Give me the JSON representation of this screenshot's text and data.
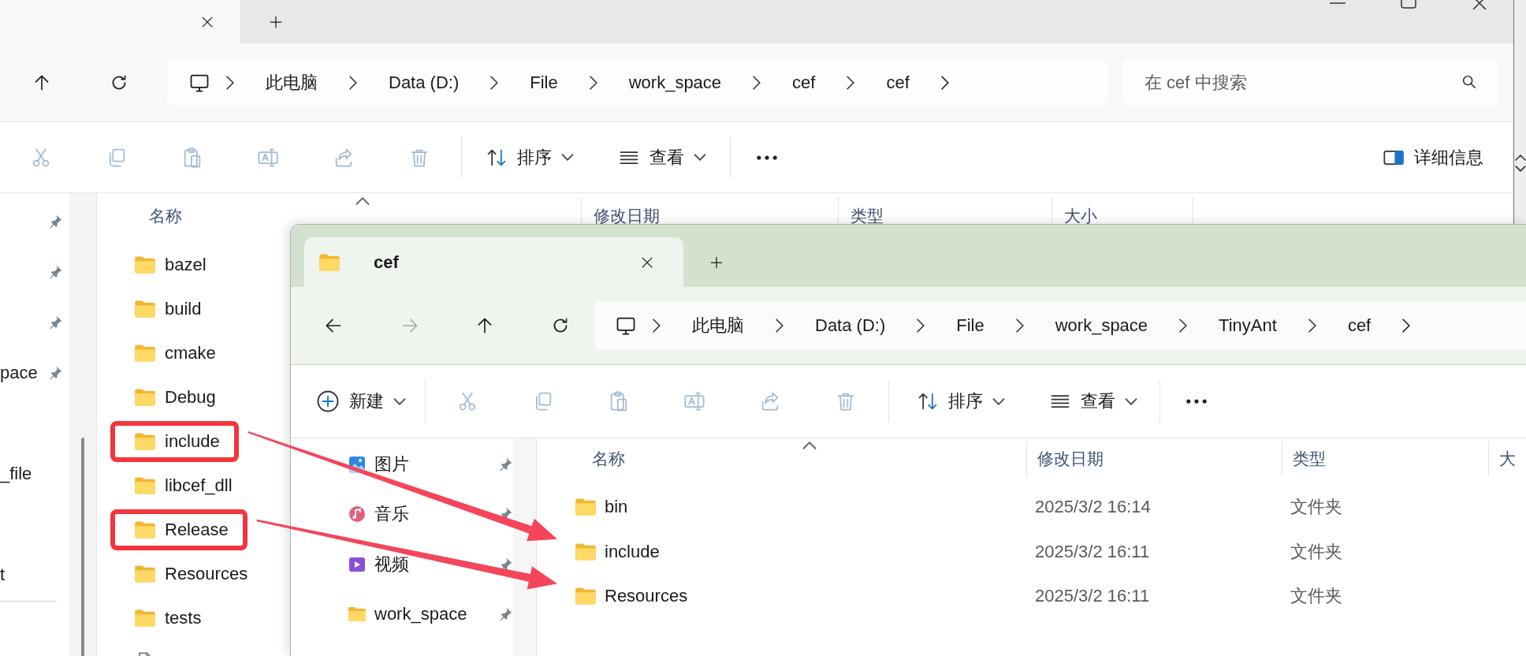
{
  "back_window": {
    "address": {
      "segments": [
        "此电脑",
        "Data (D:)",
        "File",
        "work_space",
        "cef",
        "cef"
      ]
    },
    "search": {
      "placeholder": "在 cef 中搜索"
    },
    "toolbar": {
      "actions": [
        {
          "kind": "cut",
          "disabled": true
        },
        {
          "kind": "copy",
          "disabled": true
        },
        {
          "kind": "paste",
          "disabled": true
        },
        {
          "kind": "rename",
          "disabled": true
        },
        {
          "kind": "share",
          "disabled": true
        },
        {
          "kind": "delete",
          "disabled": true
        }
      ],
      "sort": "排序",
      "view": "查看",
      "details": "详细信息"
    },
    "nav_pane": {
      "items": [
        {
          "pinned": true
        },
        {
          "pinned": true
        },
        {
          "pinned": true
        },
        {
          "label": "pace",
          "pinned": true
        },
        {
          "label": "_file",
          "pinned": false
        },
        {
          "label": "t",
          "pinned": false
        }
      ]
    },
    "file_list": {
      "columns": [
        "名称",
        "修改日期",
        "类型",
        "大小"
      ],
      "rows": [
        {
          "kind": "folder",
          "name": "bazel",
          "highlighted": false
        },
        {
          "kind": "folder",
          "name": "build",
          "highlighted": false
        },
        {
          "kind": "folder",
          "name": "cmake",
          "highlighted": false
        },
        {
          "kind": "folder",
          "name": "Debug",
          "highlighted": false
        },
        {
          "kind": "folder",
          "name": "include",
          "highlighted": true
        },
        {
          "kind": "folder",
          "name": "libcef_dll",
          "highlighted": false
        },
        {
          "kind": "folder",
          "name": "Release",
          "highlighted": true
        },
        {
          "kind": "folder",
          "name": "Resources",
          "highlighted": false
        },
        {
          "kind": "folder",
          "name": "tests",
          "highlighted": false
        },
        {
          "kind": "file",
          "highlighted": false
        }
      ]
    }
  },
  "front_window": {
    "tab": {
      "title": "cef",
      "selected": true
    },
    "forward_disabled": true,
    "address": {
      "segments": [
        "此电脑",
        "Data (D:)",
        "File",
        "work_space",
        "TinyAnt",
        "cef"
      ]
    },
    "toolbar": {
      "new": "新建",
      "actions": [
        {
          "kind": "cut",
          "disabled": true
        },
        {
          "kind": "copy",
          "disabled": true
        },
        {
          "kind": "paste",
          "disabled": true
        },
        {
          "kind": "rename",
          "disabled": true
        },
        {
          "kind": "share",
          "disabled": true
        },
        {
          "kind": "delete",
          "disabled": true
        }
      ],
      "sort": "排序",
      "view": "查看"
    },
    "nav_pane": {
      "items": [
        {
          "kind": "pictures",
          "label": "图片",
          "pinned": true
        },
        {
          "kind": "music",
          "label": "音乐",
          "pinned": true
        },
        {
          "kind": "videos",
          "label": "视频",
          "pinned": true
        },
        {
          "kind": "folder",
          "label": "work_space",
          "pinned": true
        }
      ]
    },
    "file_list": {
      "columns": [
        "名称",
        "修改日期",
        "类型",
        "大"
      ],
      "rows": [
        {
          "kind": "folder",
          "name": "bin",
          "modified": "2025/3/2 16:14",
          "type": "文件夹"
        },
        {
          "kind": "folder",
          "name": "include",
          "modified": "2025/3/2 16:11",
          "type": "文件夹",
          "arrow_target": true
        },
        {
          "kind": "folder",
          "name": "Resources",
          "modified": "2025/3/2 16:11",
          "type": "文件夹",
          "arrow_target": true
        }
      ]
    }
  }
}
